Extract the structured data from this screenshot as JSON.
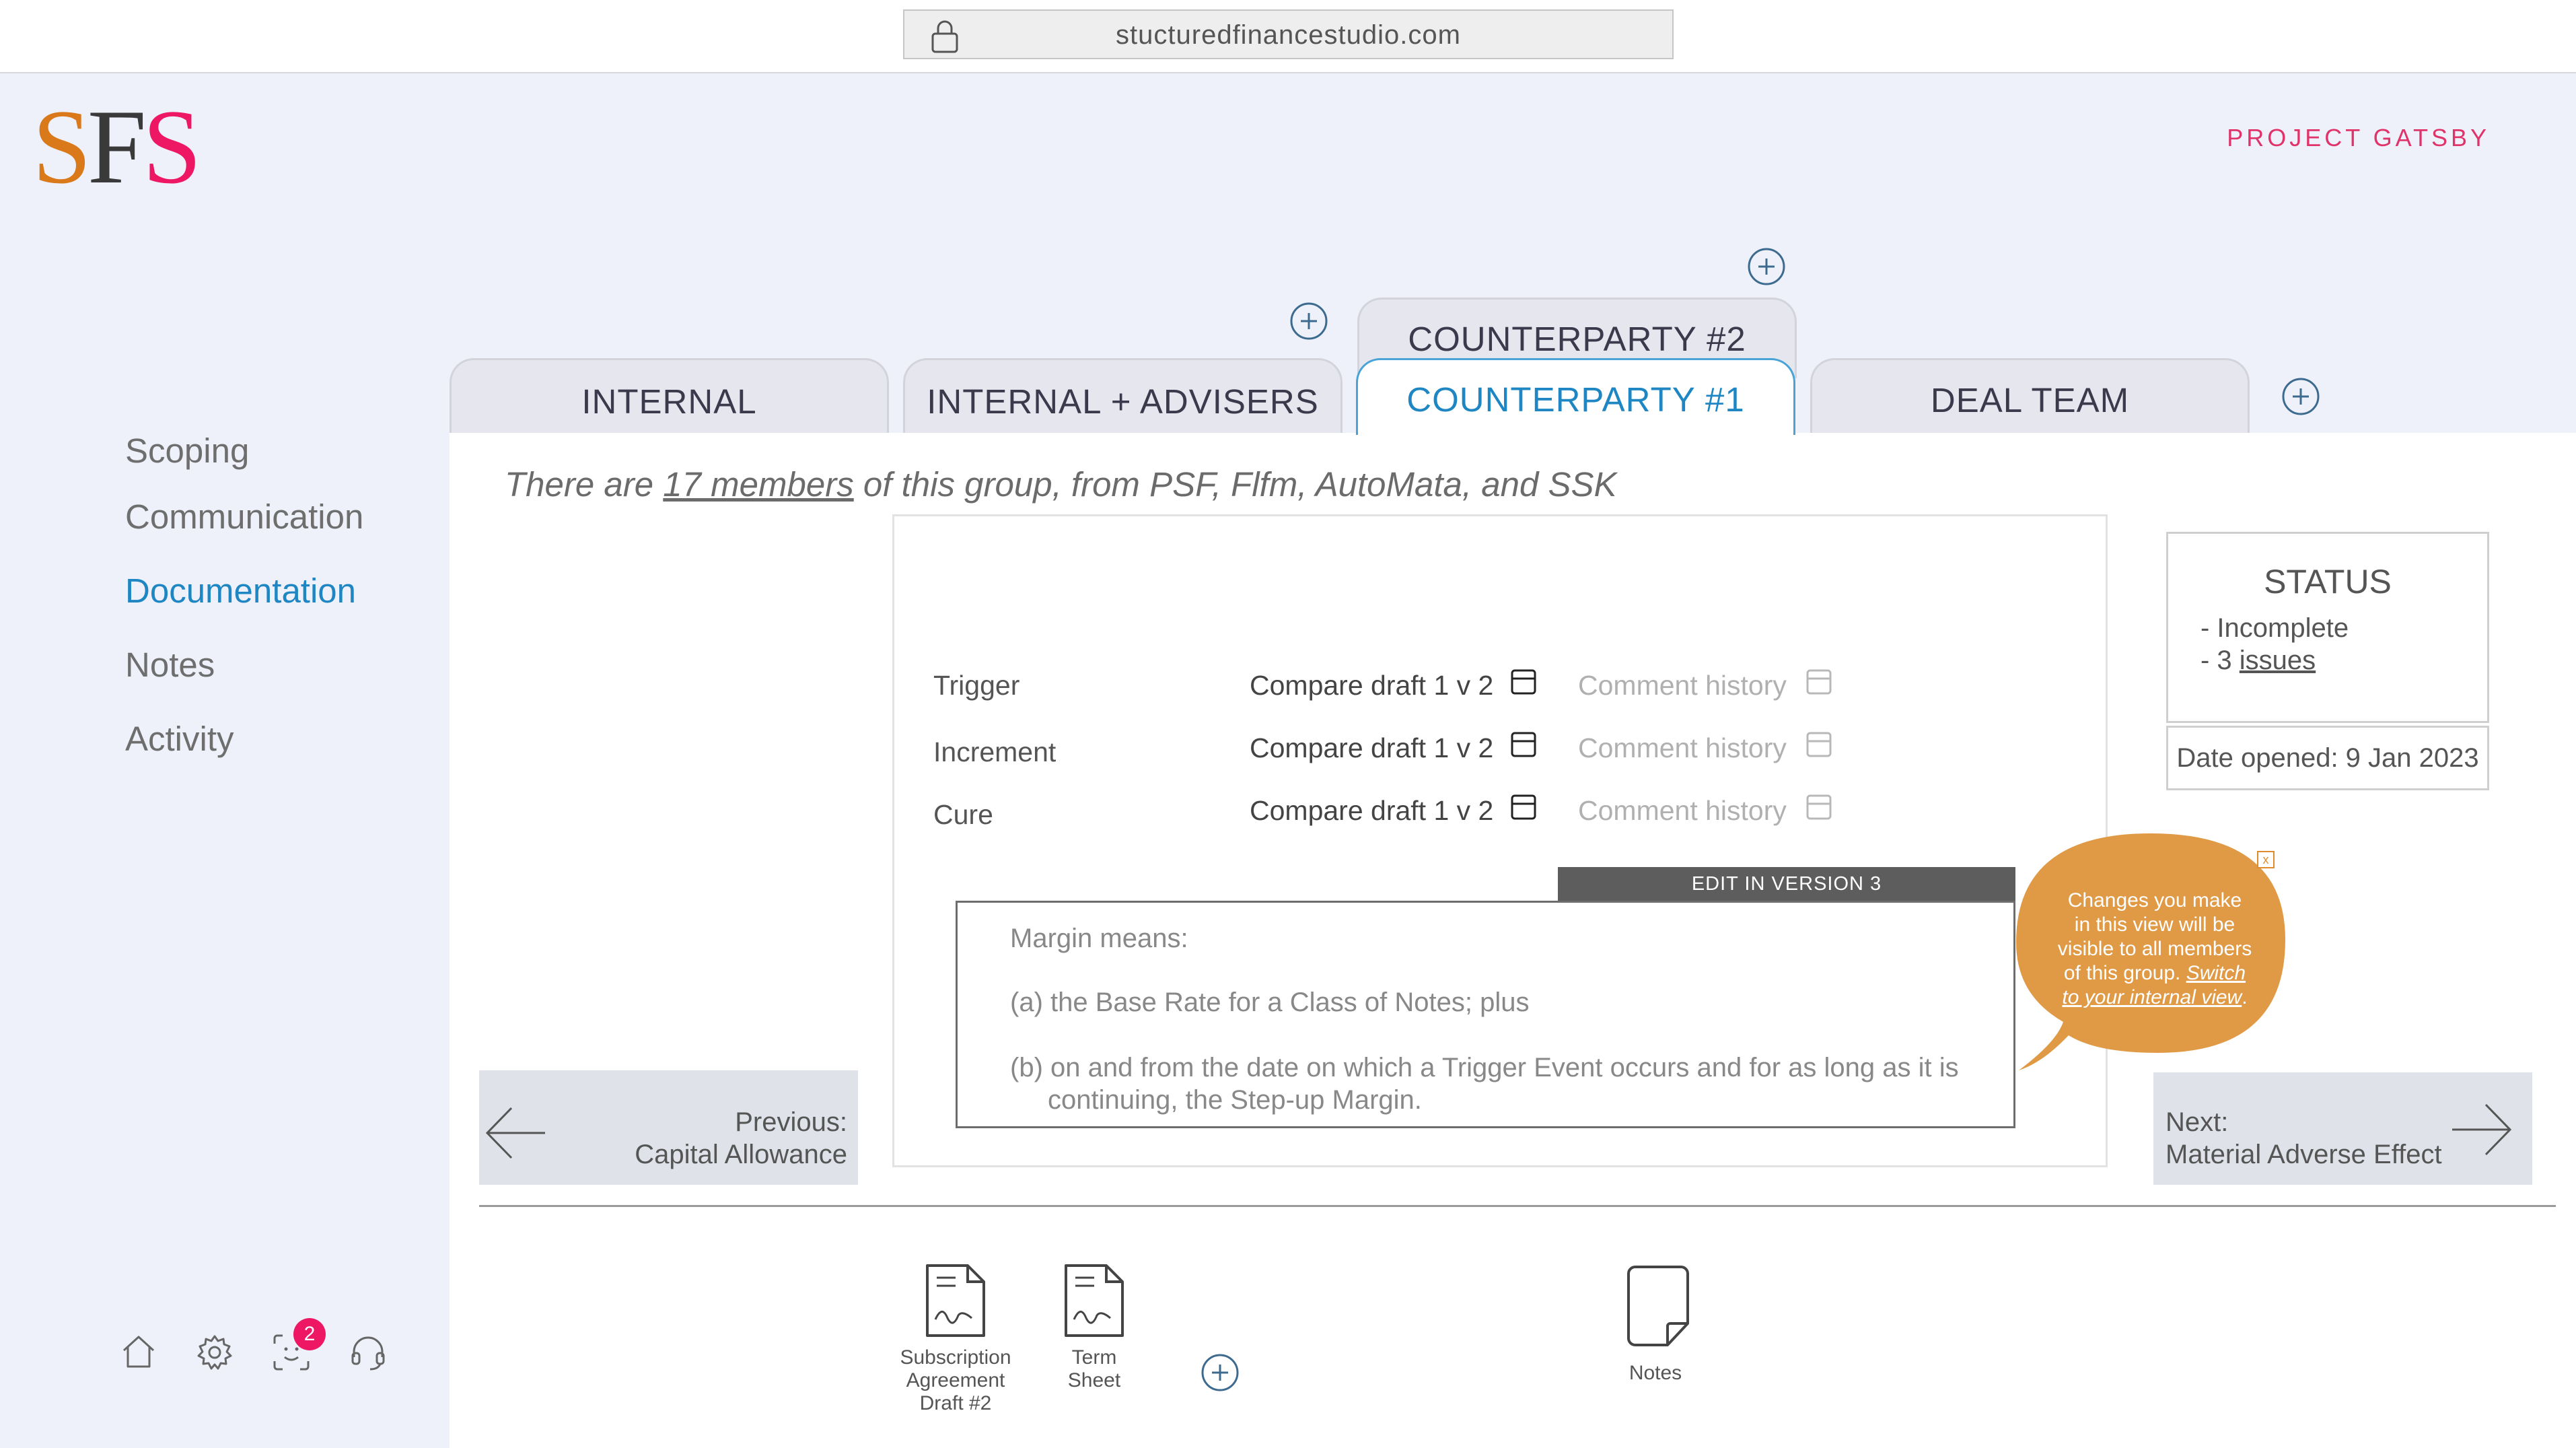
{
  "browser": {
    "url": "stucturedfinancestudio.com"
  },
  "brand": {
    "logo_letters": [
      {
        "char": "S",
        "color": "#d9791a"
      },
      {
        "char": "F",
        "color": "#3a3a3a"
      },
      {
        "char": "S",
        "color": "#ee1763"
      }
    ],
    "project": "PROJECT GATSBY"
  },
  "colors": {
    "accent": "#1e86c2",
    "brand_pink": "#ee1763",
    "bubble": "#e09a45"
  },
  "sidebar": {
    "items": [
      {
        "label": "Scoping",
        "active": false
      },
      {
        "label": "Communication",
        "active": false
      },
      {
        "label": "Documentation",
        "active": true
      },
      {
        "label": "Notes",
        "active": false
      },
      {
        "label": "Activity",
        "active": false
      }
    ],
    "bottom_icons": [
      "home-icon",
      "gear-icon",
      "face-id-icon",
      "headset-icon"
    ],
    "notification_count": "2"
  },
  "tabs": {
    "items": [
      {
        "label": "INTERNAL",
        "active": false
      },
      {
        "label": "INTERNAL + ADVISERS",
        "active": false
      },
      {
        "label": "COUNTERPARTY #1",
        "active": true
      },
      {
        "label": "COUNTERPARTY #2",
        "active": false
      },
      {
        "label": "DEAL TEAM",
        "active": false
      }
    ]
  },
  "group_info": {
    "prefix": "There are ",
    "members_link": "17 members",
    "suffix": " of this group, from PSF, Flfm, AutoMata, and SSK"
  },
  "document": {
    "rows": [
      {
        "label": "Trigger",
        "compare": "Compare draft 1 v 2",
        "comment": "Comment history"
      },
      {
        "label": "Increment",
        "compare": "Compare draft 1 v 2",
        "comment": "Comment history"
      },
      {
        "label": "Cure",
        "compare": "Compare draft 1 v 2",
        "comment": "Comment history"
      }
    ],
    "edit_label": "EDIT IN VERSION 3",
    "clause": {
      "p1": "Margin means:",
      "p2": "(a) the Base Rate for a Class of Notes; plus",
      "p3_line1": "(b) on and from the date on which a Trigger Event occurs and for as long as it is",
      "p3_line2": "continuing, the Step-up Margin."
    }
  },
  "status": {
    "title": "STATUS",
    "line1": "- Incomplete",
    "line2_prefix": "- 3 ",
    "line2_link": "issues",
    "date_opened": "Date opened: 9 Jan 2023"
  },
  "navigation": {
    "prev_label": "Previous:",
    "prev_title": "Capital Allowance",
    "next_label": "Next:",
    "next_title": "Material Adverse Effect"
  },
  "tooltip": {
    "line1": "Changes you make",
    "line2": "in this view will be",
    "line3": "visible to all members",
    "line4_prefix": "of this group. ",
    "line4_link": "Switch",
    "line5_link": "to your internal view",
    "line5_suffix": ".",
    "close": "x"
  },
  "attachments": [
    {
      "line1": "Subscription",
      "line2": "Agreement",
      "line3": "Draft #2",
      "icon": "document-icon"
    },
    {
      "line1": "Term",
      "line2": "Sheet",
      "icon": "document-icon"
    },
    {
      "line1": "Notes",
      "icon": "note-icon"
    }
  ]
}
